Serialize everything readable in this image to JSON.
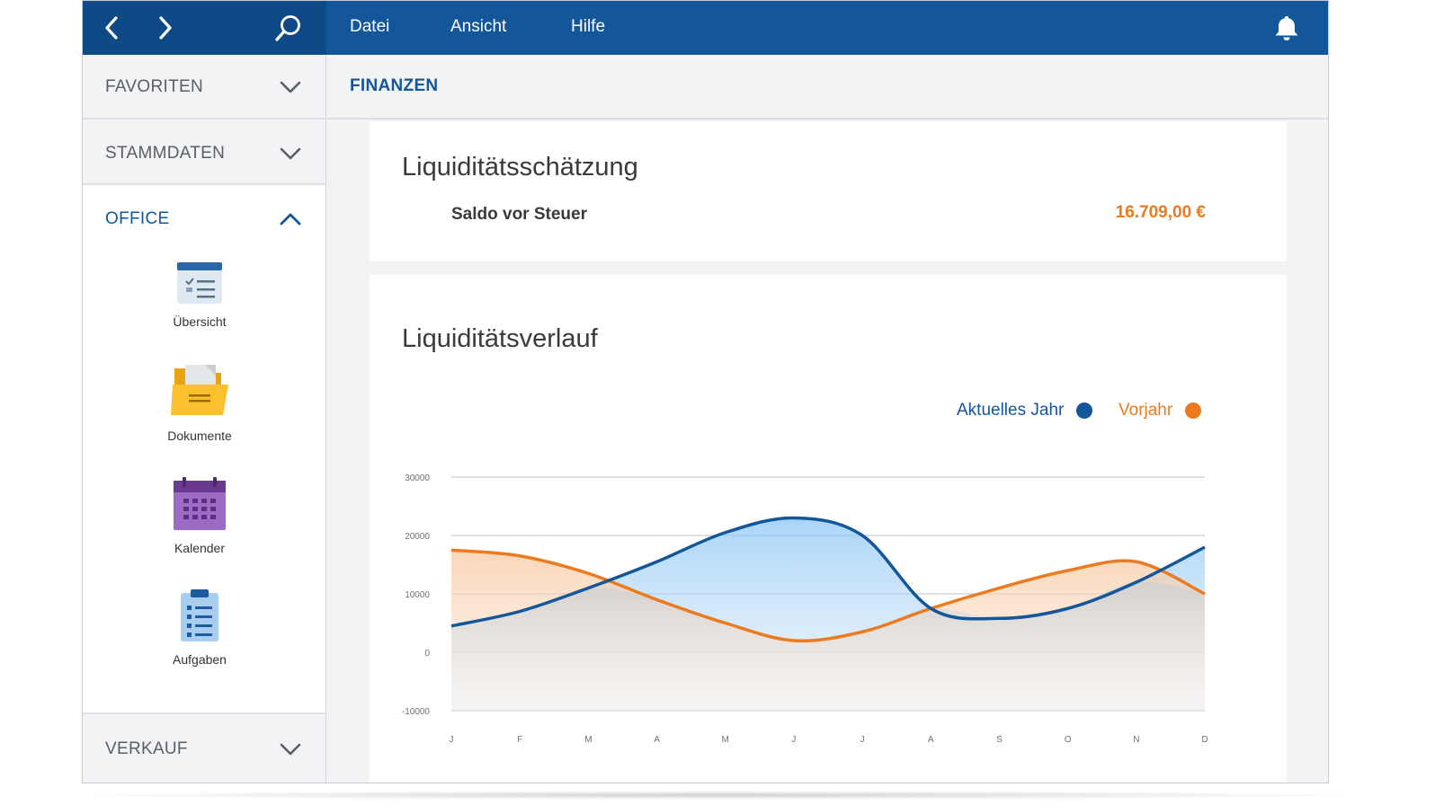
{
  "nav": {
    "back_icon": "chevron-left-icon",
    "forward_icon": "chevron-right-icon",
    "search_icon": "search-icon",
    "bell_icon": "bell-icon"
  },
  "menu": {
    "items": [
      "Datei",
      "Ansicht",
      "Hilfe"
    ]
  },
  "sidebar": {
    "sections": [
      {
        "label": "FAVORITEN",
        "expanded": false
      },
      {
        "label": "STAMMDATEN",
        "expanded": false
      },
      {
        "label": "OFFICE",
        "expanded": true
      },
      {
        "label": "VERKAUF",
        "expanded": false
      }
    ],
    "office_items": [
      {
        "label": "Übersicht",
        "icon": "overview-icon"
      },
      {
        "label": "Dokumente",
        "icon": "folder-icon"
      },
      {
        "label": "Kalender",
        "icon": "calendar-icon"
      },
      {
        "label": "Aufgaben",
        "icon": "tasks-icon"
      }
    ]
  },
  "breadcrumb": {
    "title": "FINANZEN"
  },
  "estimate": {
    "title": "Liquiditätsschätzung",
    "label": "Saldo vor Steuer",
    "value": "16.709,00 €"
  },
  "history": {
    "title": "Liquiditätsverlauf"
  },
  "colors": {
    "primary": "#14569a",
    "accent": "#ec7a1f"
  },
  "chart_data": {
    "type": "area",
    "categories": [
      "J",
      "F",
      "M",
      "A",
      "M",
      "J",
      "J",
      "A",
      "S",
      "O",
      "N",
      "D"
    ],
    "series": [
      {
        "name": "Aktuelles Jahr",
        "color": "#14569a",
        "values": [
          4500,
          7000,
          11000,
          15500,
          20500,
          23000,
          20000,
          7500,
          5800,
          7500,
          12000,
          18000
        ]
      },
      {
        "name": "Vorjahr",
        "color": "#ec7a1f",
        "values": [
          17500,
          16500,
          13500,
          9000,
          5000,
          2000,
          3500,
          7500,
          11000,
          14000,
          15500,
          10000
        ]
      }
    ],
    "yticks": [
      30000,
      20000,
      10000,
      0,
      -10000
    ],
    "ylim": [
      -10000,
      30000
    ],
    "grid": true,
    "legend_position": "top-right"
  }
}
